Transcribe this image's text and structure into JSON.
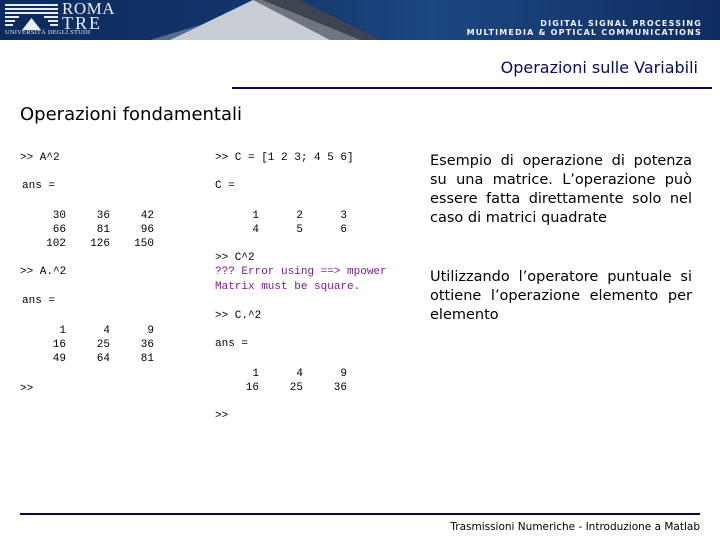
{
  "banner": {
    "logo": {
      "line1": "ROMA",
      "line2": "TRE",
      "subtitle": "UNIVERSITÀ DEGLI STUDI"
    },
    "brand_line1": "DIGITAL SIGNAL PROCESSING",
    "brand_line2": "MULTIMEDIA & OPTICAL COMMUNICATIONS",
    "colors": {
      "background": "#15376e",
      "text": "#eef2fa"
    }
  },
  "header": {
    "section_title": "Operazioni sulle Variabili",
    "page_title": "Operazioni fondamentali",
    "accent_color": "#0a0a4a"
  },
  "console_left": {
    "cmd1": ">> A^2",
    "ans1_label": "ans =",
    "ans1_matrix": [
      [
        "30",
        "36",
        "42"
      ],
      [
        "66",
        "81",
        "96"
      ],
      [
        "102",
        "126",
        "150"
      ]
    ],
    "cmd2": ">> A.^2",
    "ans2_label": "ans =",
    "ans2_matrix": [
      [
        "1",
        "4",
        "9"
      ],
      [
        "16",
        "25",
        "36"
      ],
      [
        "49",
        "64",
        "81"
      ]
    ],
    "prompt": ">>"
  },
  "console_right": {
    "cmd1": ">> C = [1 2 3; 4 5 6]",
    "c_label": "C =",
    "c_matrix": [
      [
        "1",
        "2",
        "3"
      ],
      [
        "4",
        "5",
        "6"
      ]
    ],
    "cmd2": ">> C^2",
    "error_line1": "??? Error using ==> mpower",
    "error_line2": "Matrix must be square.",
    "error_color": "#7a1f8a",
    "cmd3": ">> C.^2",
    "ans_label": "ans =",
    "ans_matrix": [
      [
        "1",
        "4",
        "9"
      ],
      [
        "16",
        "25",
        "36"
      ]
    ],
    "prompt": ">>"
  },
  "descriptions": [
    "Esempio di operazione di potenza su una matrice. L’operazione può essere fatta direttamente solo nel caso di matrici quadrate",
    "Utilizzando l’operatore puntuale si ottiene l’operazione elemento per elemento"
  ],
  "footer": {
    "text": "Trasmissioni Numeriche - Introduzione a Matlab"
  }
}
